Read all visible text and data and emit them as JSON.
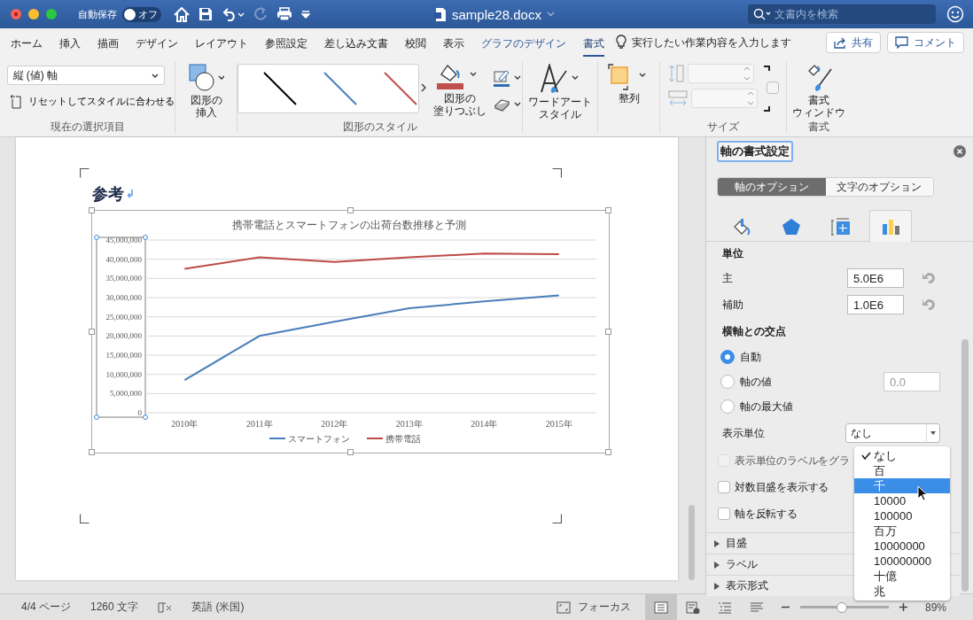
{
  "titlebar": {
    "autosave_label": "自動保存",
    "autosave": {
      "on": false,
      "label": "オフ"
    },
    "filename": "sample28.docx",
    "search": {
      "placeholder": "文書内を検索"
    }
  },
  "ribbon_tabs": [
    {
      "label": "ホーム",
      "kind": "normal",
      "selected": false
    },
    {
      "label": "挿入",
      "kind": "normal",
      "selected": false
    },
    {
      "label": "描画",
      "kind": "normal",
      "selected": false
    },
    {
      "label": "デザイン",
      "kind": "normal",
      "selected": false
    },
    {
      "label": "レイアウト",
      "kind": "normal",
      "selected": false
    },
    {
      "label": "参照設定",
      "kind": "normal",
      "selected": false
    },
    {
      "label": "差し込み文書",
      "kind": "normal",
      "selected": false
    },
    {
      "label": "校閲",
      "kind": "normal",
      "selected": false
    },
    {
      "label": "表示",
      "kind": "normal",
      "selected": false
    },
    {
      "label": "グラフのデザイン",
      "kind": "contextual",
      "selected": false
    },
    {
      "label": "書式",
      "kind": "contextual",
      "selected": true
    }
  ],
  "tell_me": "実行したい作業内容を入力します",
  "share_button": "共有",
  "comment_button": "コメント",
  "ribbon_groups": [
    {
      "kind": "selection",
      "title": "現在の選択項目",
      "dropdown": "縦 (値) 軸",
      "reset": "リセットしてスタイルに合わせる"
    },
    {
      "kind": "insert-shape",
      "button": [
        "図形の",
        "挿入"
      ]
    },
    {
      "kind": "shape-styles",
      "title": "図形のスタイル",
      "fill_button": [
        "図形の",
        "塗りつぶし"
      ]
    },
    {
      "kind": "wordart",
      "button": [
        "ワードアート",
        "スタイル"
      ]
    },
    {
      "kind": "arrange",
      "button": [
        "整列"
      ]
    },
    {
      "kind": "size",
      "title": "サイズ",
      "disabled": true,
      "lock_aspect": false
    },
    {
      "kind": "format-pane",
      "title": "書式",
      "button": [
        "書式",
        "ウィンドウ"
      ]
    }
  ],
  "document": {
    "heading": "参考",
    "paragraph_mark": "↲",
    "chart": {
      "selected": true,
      "axis_selected": true,
      "chart_data": {
        "type": "line",
        "title": "携帯電話とスマートフォンの出荷台数推移と予測",
        "categories": [
          "2010年",
          "2011年",
          "2012年",
          "2013年",
          "2014年",
          "2015年"
        ],
        "series": [
          {
            "name": "スマートフォン",
            "color": "#4a7ebb",
            "values": [
              8500000,
              20000000,
              23700000,
              27200000,
              29000000,
              30600000
            ]
          },
          {
            "name": "携帯電話",
            "color": "#be4b48",
            "values": [
              37500000,
              40500000,
              39300000,
              40500000,
              41500000,
              41300000
            ]
          }
        ],
        "grid": true,
        "legend": "bottom",
        "ylim": [
          0,
          45000000
        ],
        "yticks": [
          {
            "value": 0,
            "label": "0"
          },
          {
            "value": 5000000,
            "label": "5,000,000"
          },
          {
            "value": 10000000,
            "label": "10,000,000"
          },
          {
            "value": 15000000,
            "label": "15,000,000"
          },
          {
            "value": 20000000,
            "label": "20,000,000"
          },
          {
            "value": 25000000,
            "label": "25,000,000"
          },
          {
            "value": 30000000,
            "label": "30,000,000"
          },
          {
            "value": 35000000,
            "label": "35,000,000"
          },
          {
            "value": 40000000,
            "label": "40,000,000"
          },
          {
            "value": 45000000,
            "label": "45,000,000"
          }
        ]
      }
    }
  },
  "format_pane": {
    "title": "軸の書式設定",
    "option_tabs": [
      {
        "label": "軸のオプション",
        "selected": true
      },
      {
        "label": "文字のオプション",
        "selected": false
      }
    ],
    "icon_tabs": [
      {
        "kind": "fill",
        "selected": false
      },
      {
        "kind": "effects",
        "selected": false
      },
      {
        "kind": "size",
        "selected": false
      },
      {
        "kind": "axis",
        "selected": true
      }
    ],
    "units_heading": "単位",
    "units": [
      {
        "label": "主",
        "value": "5.0E6"
      },
      {
        "label": "補助",
        "value": "1.0E6"
      }
    ],
    "crosses_heading": "横軸との交点",
    "crosses": [
      {
        "label": "自動",
        "selected": true
      },
      {
        "label": "軸の値",
        "selected": false,
        "value": "0.0",
        "value_disabled": true
      },
      {
        "label": "軸の最大値",
        "selected": false
      }
    ],
    "display_units": {
      "label": "表示単位",
      "value": "なし"
    },
    "checkboxes": [
      {
        "label": "表示単位のラベルをグラ",
        "checked": false,
        "disabled": true
      },
      {
        "label": "対数目盛を表示する",
        "checked": false,
        "disabled": false
      },
      {
        "label": "軸を反転する",
        "checked": false,
        "disabled": false
      }
    ],
    "sections": [
      {
        "label": "目盛",
        "expanded": false
      },
      {
        "label": "ラベル",
        "expanded": false
      },
      {
        "label": "表示形式",
        "expanded": false
      }
    ],
    "units_menu": [
      {
        "label": "なし",
        "checked": true,
        "selected": false
      },
      {
        "label": "百",
        "checked": false,
        "selected": false
      },
      {
        "label": "千",
        "checked": false,
        "selected": true
      },
      {
        "label": "10000",
        "checked": false,
        "selected": false
      },
      {
        "label": "100000",
        "checked": false,
        "selected": false
      },
      {
        "label": "百万",
        "checked": false,
        "selected": false
      },
      {
        "label": "10000000",
        "checked": false,
        "selected": false
      },
      {
        "label": "100000000",
        "checked": false,
        "selected": false
      },
      {
        "label": "十億",
        "checked": false,
        "selected": false
      },
      {
        "label": "兆",
        "checked": false,
        "selected": false
      }
    ]
  },
  "status_bar": {
    "page": "4/4 ページ",
    "words": "1260 文字",
    "language": "英語 (米国)",
    "focus": "フォーカス",
    "views": [
      {
        "selected": true
      },
      {
        "selected": false
      },
      {
        "selected": false
      },
      {
        "selected": false
      }
    ],
    "zoom": {
      "level": 0.47,
      "reading": "89%"
    }
  }
}
